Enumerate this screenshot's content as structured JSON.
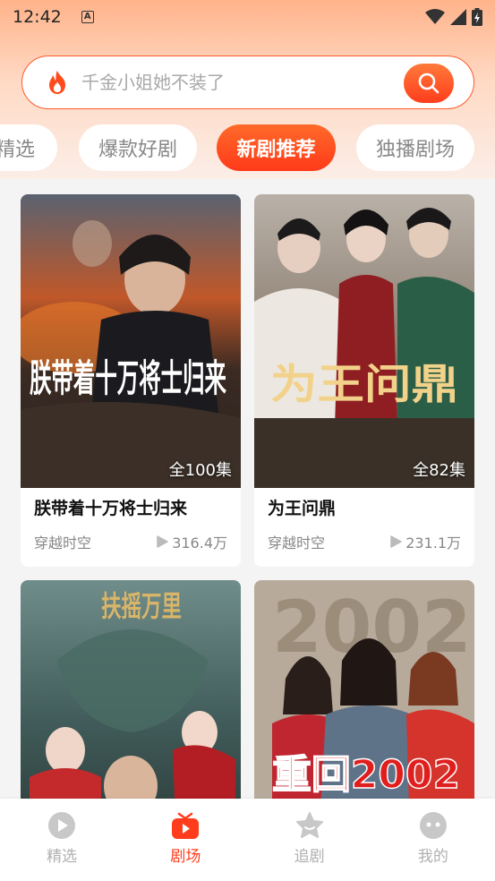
{
  "status_bar": {
    "time": "12:42",
    "notification_letter": "A"
  },
  "search": {
    "placeholder": "千金小姐她不装了"
  },
  "tabs": [
    {
      "label": "精选"
    },
    {
      "label": "爆款好剧"
    },
    {
      "label": "新剧推荐"
    },
    {
      "label": "独播剧场"
    }
  ],
  "active_tab": "新剧推荐",
  "cards": [
    {
      "title": "朕带着十万将士归来",
      "poster_text": "朕带着十万将士归来",
      "episodes": "全100集",
      "genre": "穿越时空",
      "views": "316.4万"
    },
    {
      "title": "为王问鼎",
      "poster_text": "为王问鼎",
      "episodes": "全82集",
      "genre": "穿越时空",
      "views": "231.1万"
    },
    {
      "title": "",
      "poster_text": "扶摇万里",
      "episodes": "",
      "genre": "",
      "views": ""
    },
    {
      "title": "",
      "poster_text": "重回2002",
      "episodes": "",
      "genre": "",
      "views": ""
    }
  ],
  "bottom_nav": [
    {
      "label": "精选",
      "icon": "play-circle-icon"
    },
    {
      "label": "剧场",
      "icon": "tv-icon"
    },
    {
      "label": "追剧",
      "icon": "star-icon"
    },
    {
      "label": "我的",
      "icon": "face-icon"
    }
  ],
  "colors": {
    "accent": "#ff3d1c",
    "search_border": "#ff5a2a"
  }
}
